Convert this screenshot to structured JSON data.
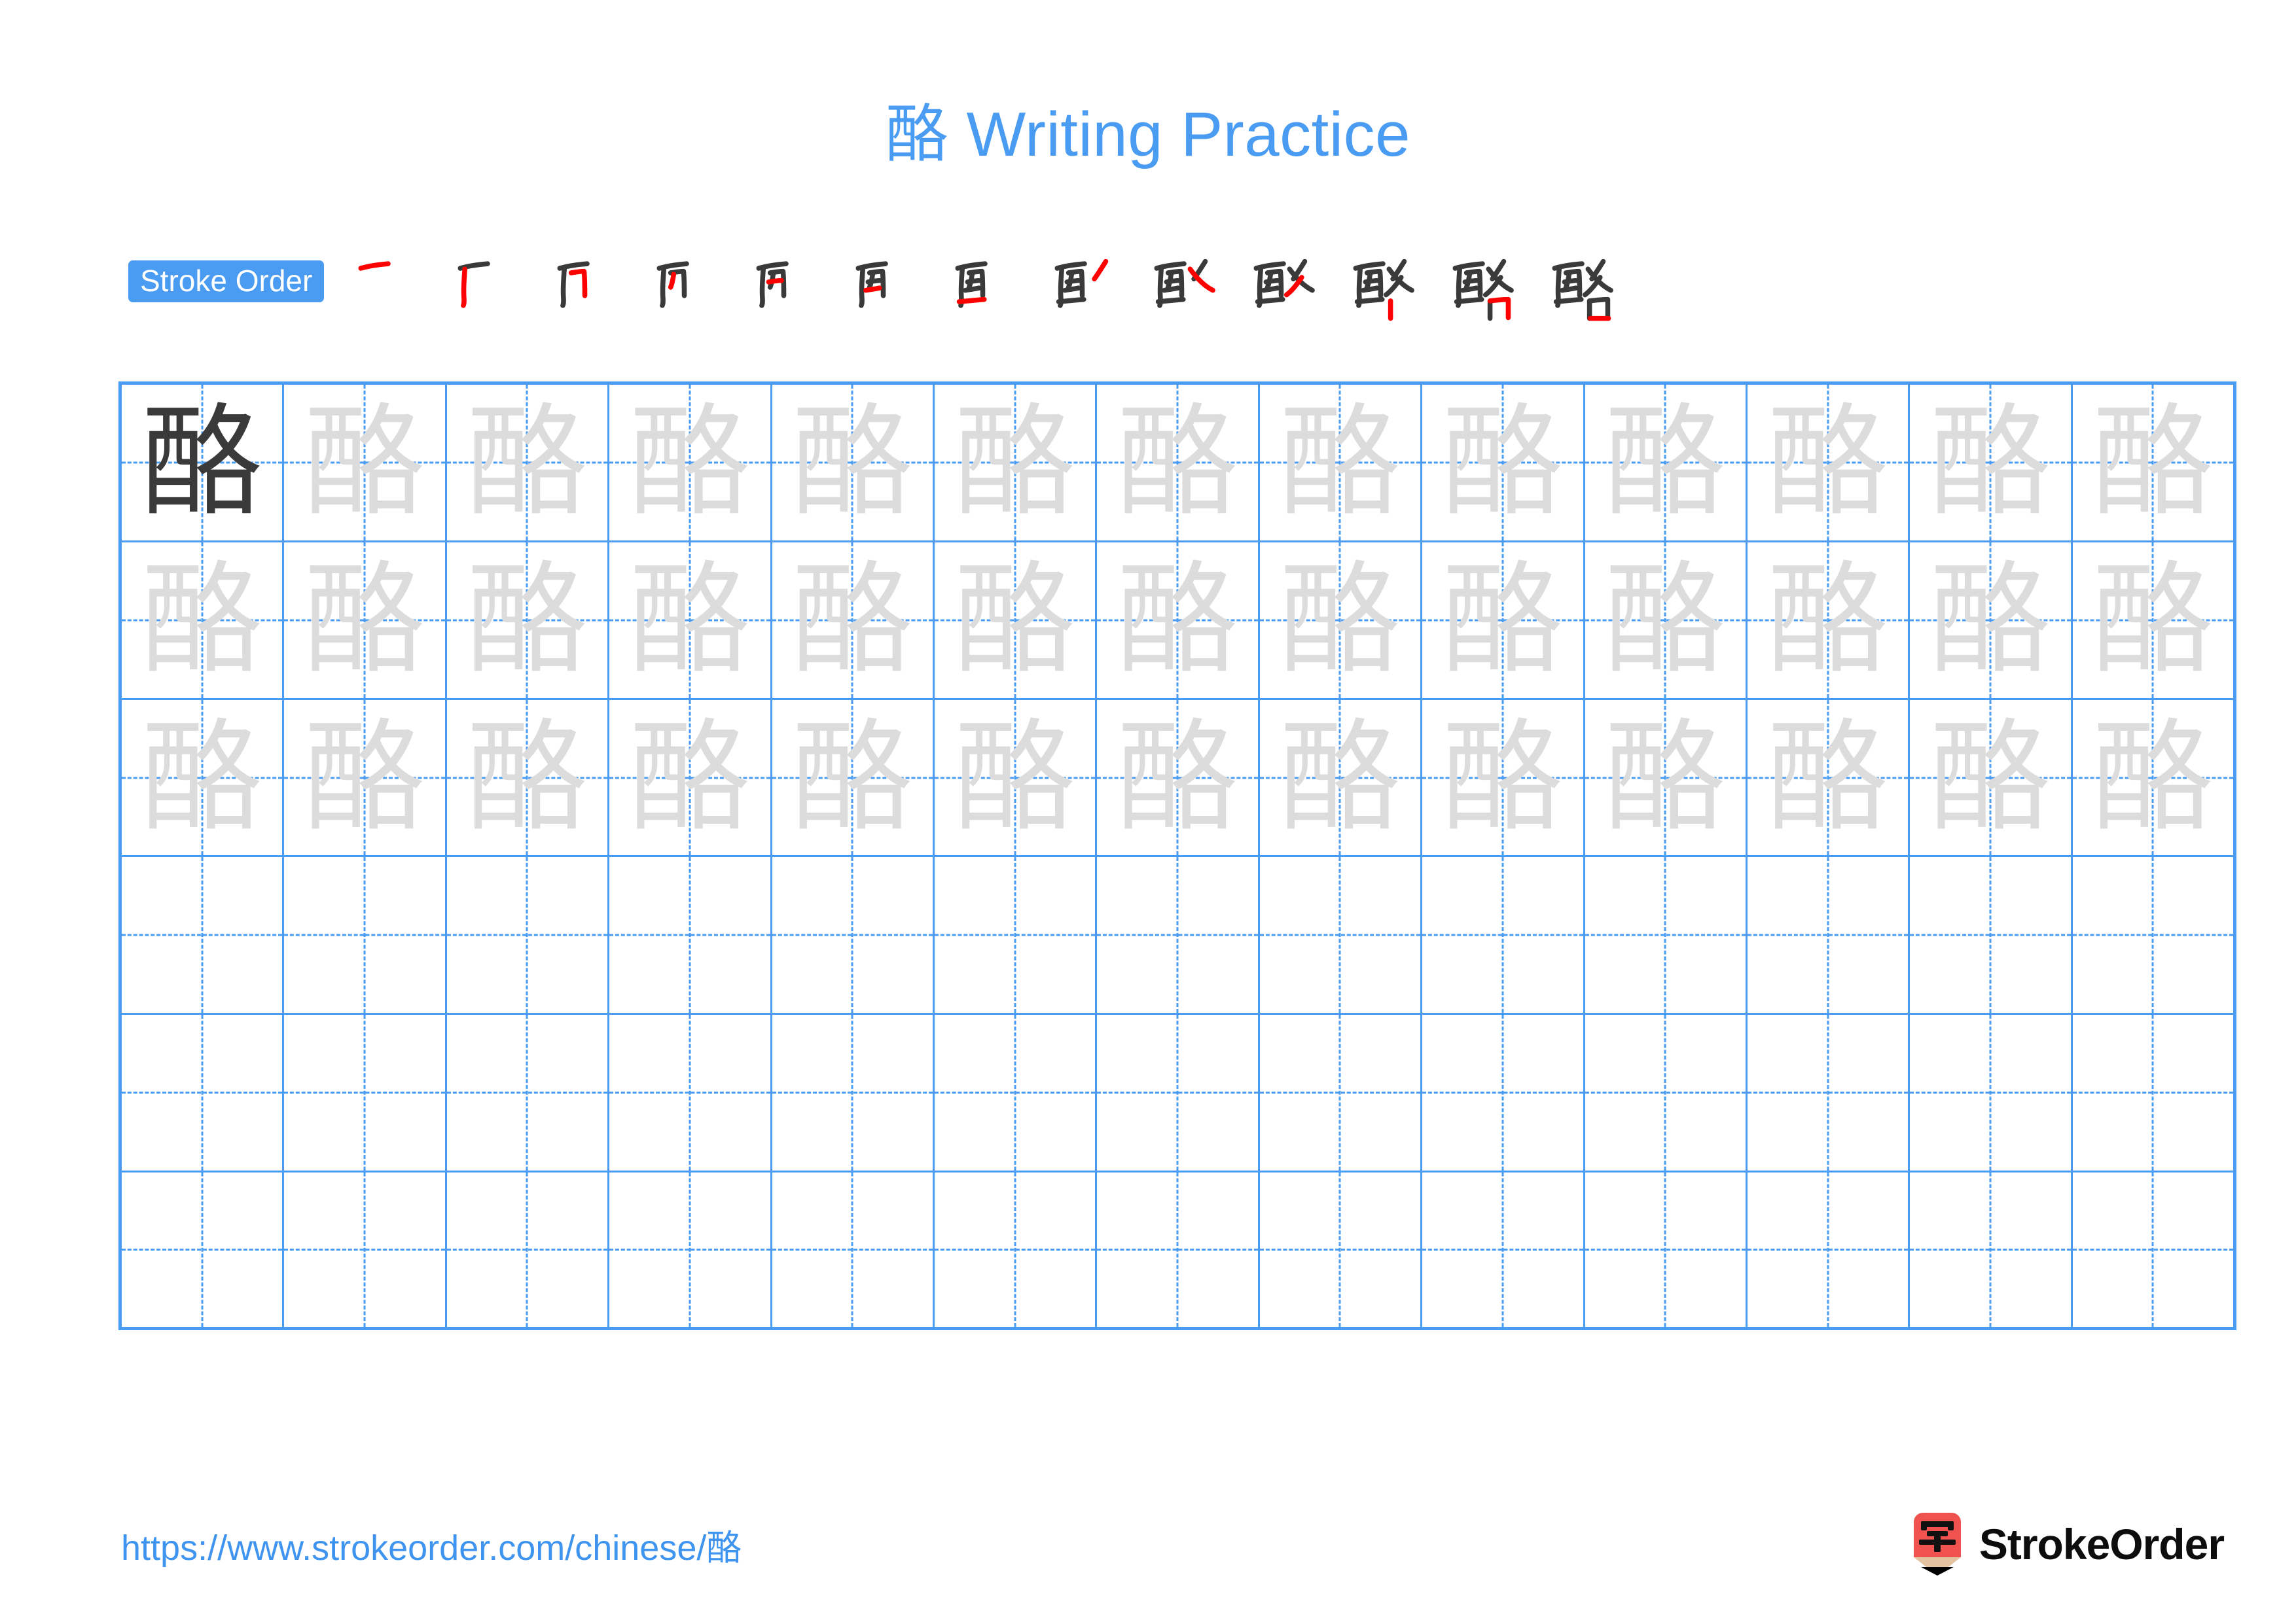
{
  "document": {
    "character": "酪",
    "title": "酪 Writing Practice",
    "accent_color": "#4a9cf2",
    "trace_color": "#dcdcdc",
    "ink_color": "#3a3a3a",
    "highlight_stroke_color": "#ff0000"
  },
  "stroke_order": {
    "label": "Stroke Order",
    "total_strokes": 13,
    "steps": [
      {
        "index": 1,
        "partial": "一"
      },
      {
        "index": 2,
        "partial": "厂"
      },
      {
        "index": 3,
        "partial": "冂"
      },
      {
        "index": 4,
        "partial": "丙"
      },
      {
        "index": 5,
        "partial": "襾"
      },
      {
        "index": 6,
        "partial": "西"
      },
      {
        "index": 7,
        "partial": "酉"
      },
      {
        "index": 8,
        "partial": "酉丿"
      },
      {
        "index": 9,
        "partial": "酌"
      },
      {
        "index": 10,
        "partial": "酚"
      },
      {
        "index": 11,
        "partial": "酪"
      },
      {
        "index": 12,
        "partial": "酪"
      },
      {
        "index": 13,
        "partial": "酪"
      }
    ]
  },
  "practice_grid": {
    "columns": 13,
    "rows": 6,
    "filled_rows": 3,
    "empty_rows": 3,
    "model_char": "酪",
    "trace_char": "酪"
  },
  "footer": {
    "url": "https://www.strokeorder.com/chinese/酪",
    "brand_name": "StrokeOrder",
    "brand_icon_char": "字",
    "brand_icon_color": "#f0534f",
    "brand_icon_tip_color": "#e3c2a0"
  }
}
